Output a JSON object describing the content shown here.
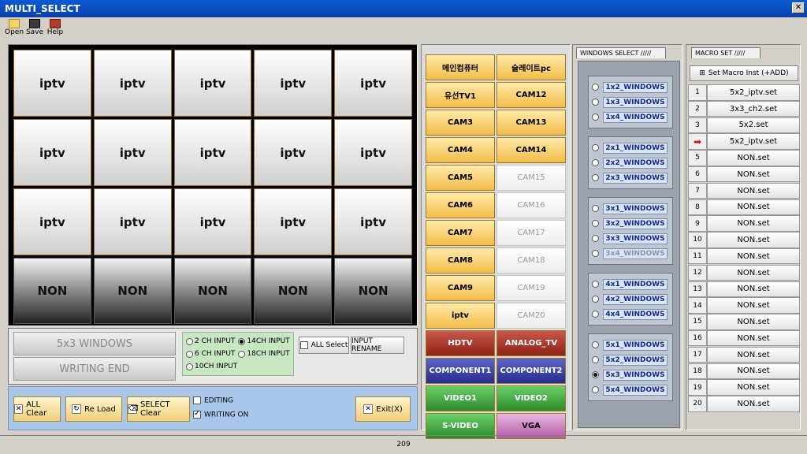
{
  "window": {
    "title": "MULTI_SELECT"
  },
  "toolbar": {
    "open": "Open",
    "save": "Save",
    "help": "Help"
  },
  "grid": {
    "rows": [
      [
        "iptv",
        "iptv",
        "iptv",
        "iptv",
        "iptv"
      ],
      [
        "iptv",
        "iptv",
        "iptv",
        "iptv",
        "iptv"
      ],
      [
        "iptv",
        "iptv",
        "iptv",
        "iptv",
        "iptv"
      ],
      [
        "NON",
        "NON",
        "NON",
        "NON",
        "NON"
      ]
    ]
  },
  "status": {
    "layout": "5x3 WINDOWS",
    "mode": "WRITING END"
  },
  "inputs": {
    "options": [
      {
        "label": "2 CH INPUT",
        "checked": false
      },
      {
        "label": "14CH INPUT",
        "checked": true
      },
      {
        "label": "6 CH INPUT",
        "checked": false
      },
      {
        "label": "18CH INPUT",
        "checked": false
      },
      {
        "label": "10CH INPUT",
        "checked": false
      }
    ],
    "all_select": "ALL Select",
    "rename": "INPUT RENAME"
  },
  "actions": {
    "all_clear": "ALL Clear",
    "reload": "Re Load",
    "select_clear": "SELECT Clear",
    "editing": "EDITING",
    "writing_on": "WRITING ON",
    "exit": "Exit(X)"
  },
  "input_buttons": [
    {
      "label": "메인컴퓨터",
      "style": "on"
    },
    {
      "label": "슬레이트pc",
      "style": "on"
    },
    {
      "label": "유선TV1",
      "style": "on"
    },
    {
      "label": "CAM12",
      "style": "on"
    },
    {
      "label": "CAM3",
      "style": "on"
    },
    {
      "label": "CAM13",
      "style": "on"
    },
    {
      "label": "CAM4",
      "style": "on"
    },
    {
      "label": "CAM14",
      "style": "on"
    },
    {
      "label": "CAM5",
      "style": "on"
    },
    {
      "label": "CAM15",
      "style": "off"
    },
    {
      "label": "CAM6",
      "style": "on"
    },
    {
      "label": "CAM16",
      "style": "off"
    },
    {
      "label": "CAM7",
      "style": "on"
    },
    {
      "label": "CAM17",
      "style": "off"
    },
    {
      "label": "CAM8",
      "style": "on"
    },
    {
      "label": "CAM18",
      "style": "off"
    },
    {
      "label": "CAM9",
      "style": "on"
    },
    {
      "label": "CAM19",
      "style": "off"
    },
    {
      "label": "iptv",
      "style": "on"
    },
    {
      "label": "CAM20",
      "style": "off"
    },
    {
      "label": "HDTV",
      "style": "red"
    },
    {
      "label": "ANALOG_TV",
      "style": "red"
    },
    {
      "label": "COMPONENT1",
      "style": "blue"
    },
    {
      "label": "COMPONENT2",
      "style": "blue"
    },
    {
      "label": "VIDEO1",
      "style": "green"
    },
    {
      "label": "VIDEO2",
      "style": "green"
    },
    {
      "label": "S-VIDEO",
      "style": "green"
    },
    {
      "label": "VGA",
      "style": "pink"
    }
  ],
  "windows_select": {
    "tab": "WINDOWS SELECT",
    "groups": [
      [
        {
          "label": "1x2_WINDOWS",
          "selected": false,
          "enabled": true
        },
        {
          "label": "1x3_WINDOWS",
          "selected": false,
          "enabled": true
        },
        {
          "label": "1x4_WINDOWS",
          "selected": false,
          "enabled": true
        }
      ],
      [
        {
          "label": "2x1_WINDOWS",
          "selected": false,
          "enabled": true
        },
        {
          "label": "2x2_WINDOWS",
          "selected": false,
          "enabled": true
        },
        {
          "label": "2x3_WINDOWS",
          "selected": false,
          "enabled": true
        }
      ],
      [
        {
          "label": "3x1_WINDOWS",
          "selected": false,
          "enabled": true
        },
        {
          "label": "3x2_WINDOWS",
          "selected": false,
          "enabled": true
        },
        {
          "label": "3x3_WINDOWS",
          "selected": false,
          "enabled": true
        },
        {
          "label": "3x4_WINDOWS",
          "selected": false,
          "enabled": false
        }
      ],
      [
        {
          "label": "4x1_WINDOWS",
          "selected": false,
          "enabled": true
        },
        {
          "label": "4x2_WINDOWS",
          "selected": false,
          "enabled": true
        },
        {
          "label": "4x4_WINDOWS",
          "selected": false,
          "enabled": true
        }
      ],
      [
        {
          "label": "5x1_WINDOWS",
          "selected": false,
          "enabled": true
        },
        {
          "label": "5x2_WINDOWS",
          "selected": false,
          "enabled": true
        },
        {
          "label": "5x3_WINDOWS",
          "selected": true,
          "enabled": true
        },
        {
          "label": "5x4_WINDOWS",
          "selected": false,
          "enabled": true
        }
      ]
    ]
  },
  "macro": {
    "tab": "MACRO SET",
    "add_label": "Set Macro Inst (+ADD)",
    "items": [
      {
        "num": "1",
        "name": "5x2_iptv.set",
        "current": false
      },
      {
        "num": "2",
        "name": "3x3_ch2.set",
        "current": false
      },
      {
        "num": "3",
        "name": "5x2.set",
        "current": false
      },
      {
        "num": "4",
        "name": "5x2_iptv.set",
        "current": true
      },
      {
        "num": "5",
        "name": "NON.set",
        "current": false
      },
      {
        "num": "6",
        "name": "NON.set",
        "current": false
      },
      {
        "num": "7",
        "name": "NON.set",
        "current": false
      },
      {
        "num": "8",
        "name": "NON.set",
        "current": false
      },
      {
        "num": "9",
        "name": "NON.set",
        "current": false
      },
      {
        "num": "10",
        "name": "NON.set",
        "current": false
      },
      {
        "num": "11",
        "name": "NON.set",
        "current": false
      },
      {
        "num": "12",
        "name": "NON.set",
        "current": false
      },
      {
        "num": "13",
        "name": "NON.set",
        "current": false
      },
      {
        "num": "14",
        "name": "NON.set",
        "current": false
      },
      {
        "num": "15",
        "name": "NON.set",
        "current": false
      },
      {
        "num": "16",
        "name": "NON.set",
        "current": false
      },
      {
        "num": "17",
        "name": "NON.set",
        "current": false
      },
      {
        "num": "18",
        "name": "NON.set",
        "current": false
      },
      {
        "num": "19",
        "name": "NON.set",
        "current": false
      },
      {
        "num": "20",
        "name": "NON.set",
        "current": false
      }
    ]
  },
  "statusbar": {
    "text": "209"
  }
}
